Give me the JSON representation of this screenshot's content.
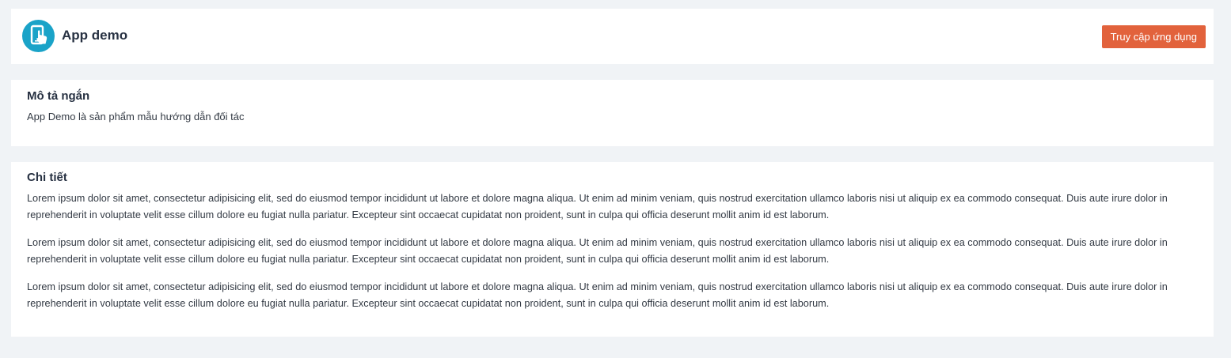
{
  "header": {
    "app_name": "App demo",
    "access_button": "Truy cập ứng dụng",
    "logo_icon": "phone-touch-icon",
    "logo_color": "#1aa3c8",
    "button_color": "#e2623c"
  },
  "short_description": {
    "title": "Mô tả ngắn",
    "text": "App Demo là sản phẩm mẫu hướng dẫn đối tác"
  },
  "details": {
    "title": "Chi tiết",
    "paragraphs": [
      "Lorem ipsum dolor sit amet, consectetur adipisicing elit, sed do eiusmod tempor incididunt ut labore et dolore magna aliqua. Ut enim ad minim veniam, quis nostrud exercitation ullamco laboris nisi ut aliquip ex ea commodo consequat. Duis aute irure dolor in reprehenderit in voluptate velit esse cillum dolore eu fugiat nulla pariatur. Excepteur sint occaecat cupidatat non proident, sunt in culpa qui officia deserunt mollit anim id est laborum.",
      "Lorem ipsum dolor sit amet, consectetur adipisicing elit, sed do eiusmod tempor incididunt ut labore et dolore magna aliqua. Ut enim ad minim veniam, quis nostrud exercitation ullamco laboris nisi ut aliquip ex ea commodo consequat. Duis aute irure dolor in reprehenderit in voluptate velit esse cillum dolore eu fugiat nulla pariatur. Excepteur sint occaecat cupidatat non proident, sunt in culpa qui officia deserunt mollit anim id est laborum.",
      "Lorem ipsum dolor sit amet, consectetur adipisicing elit, sed do eiusmod tempor incididunt ut labore et dolore magna aliqua. Ut enim ad minim veniam, quis nostrud exercitation ullamco laboris nisi ut aliquip ex ea commodo consequat. Duis aute irure dolor in reprehenderit in voluptate velit esse cillum dolore eu fugiat nulla pariatur. Excepteur sint occaecat cupidatat non proident, sunt in culpa qui officia deserunt mollit anim id est laborum."
    ]
  }
}
